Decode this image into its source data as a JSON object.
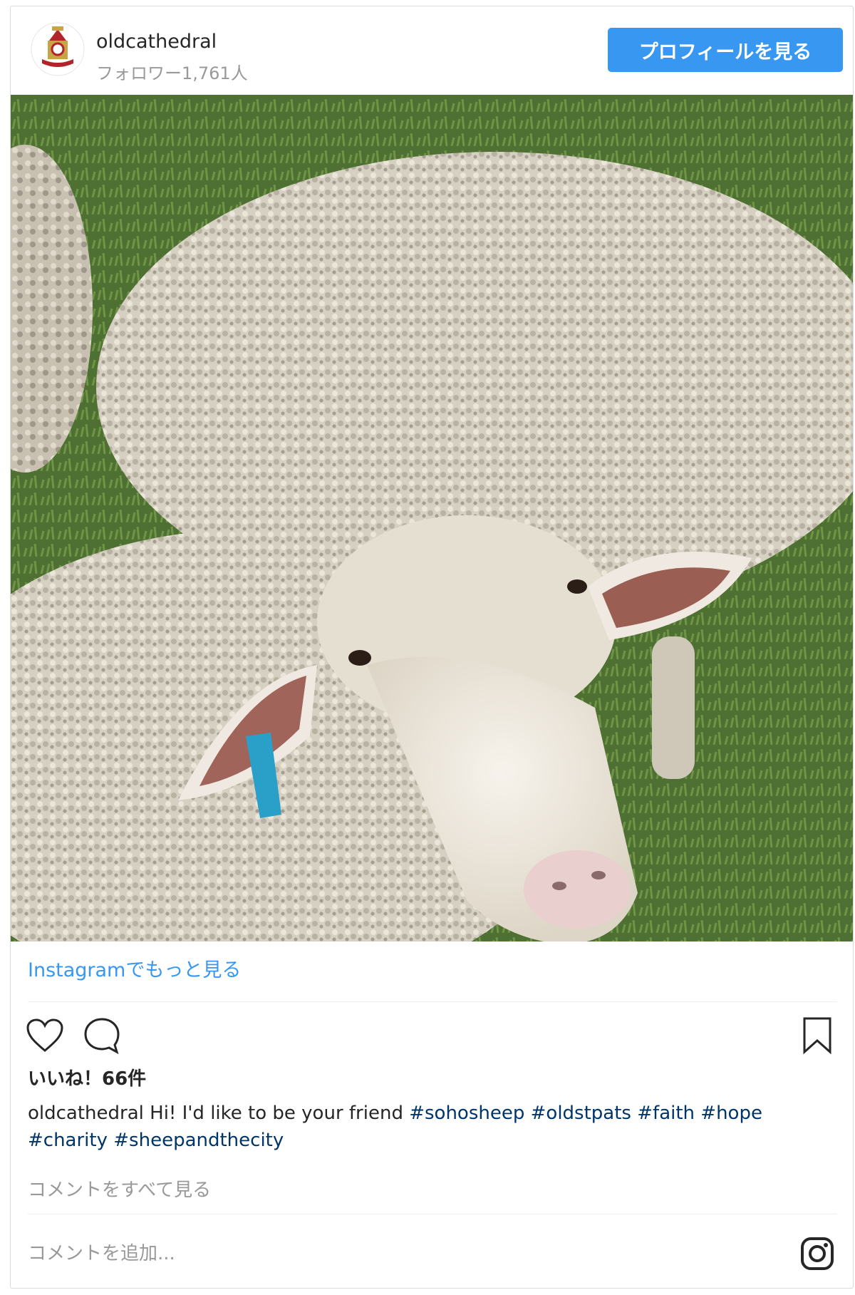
{
  "header": {
    "username": "oldcathedral",
    "followers": "フォロワー1,761人",
    "profile_button": "プロフィールを見る"
  },
  "photo": {
    "subject": "sheep"
  },
  "footer": {
    "more_link": "Instagramでもっと見る",
    "likes": "いいね！66件",
    "caption_user": "oldcathedral",
    "caption_text": "Hi! I'd like to be your friend",
    "hashtags": [
      "#sohosheep",
      "#oldstpats",
      "#faith",
      "#hope",
      "#charity",
      "#sheepandthecity"
    ],
    "view_all_comments": "コメントをすべて見る",
    "comment_placeholder": "コメントを追加..."
  },
  "icons": {
    "like": "heart-icon",
    "comment": "comment-icon",
    "save": "bookmark-icon",
    "instagram": "instagram-icon"
  },
  "colors": {
    "accent": "#3897f0",
    "hashtag": "#003569",
    "muted": "#999999"
  }
}
